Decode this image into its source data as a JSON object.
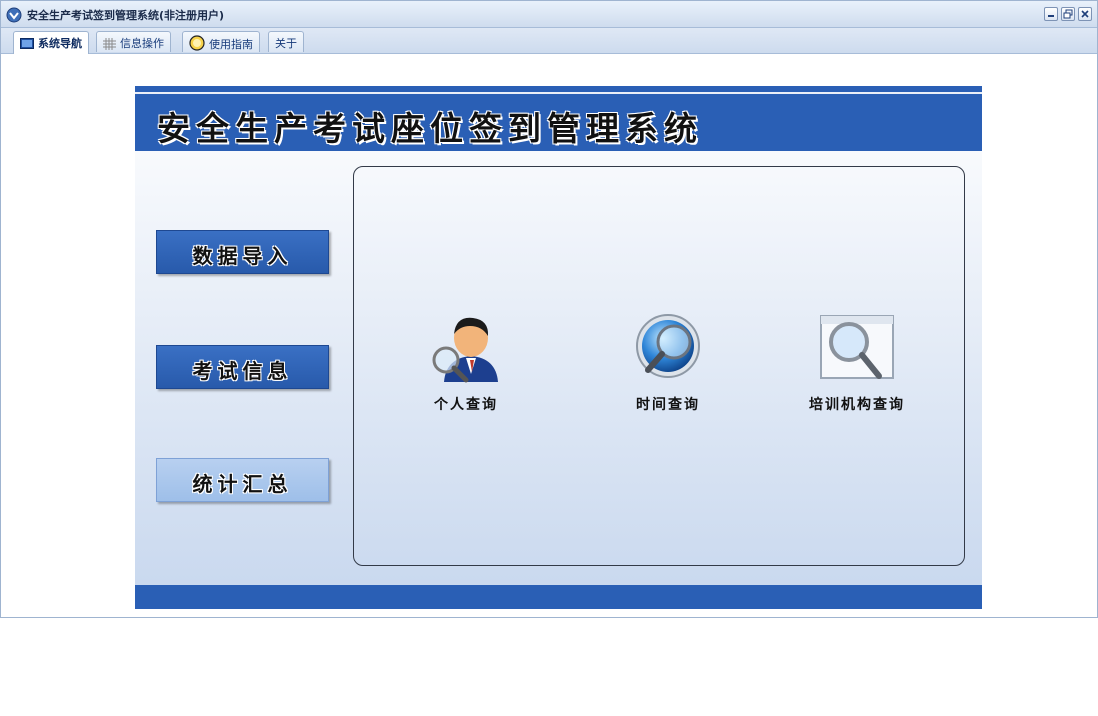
{
  "window": {
    "title": "安全生产考试签到管理系统(非注册用户)",
    "icon": "app-logo-icon",
    "controls": [
      "minimize-icon",
      "restore-icon",
      "close-icon"
    ]
  },
  "tabs": [
    {
      "label": "系统导航",
      "icon": "monitor-icon",
      "active": true
    },
    {
      "label": "信息操作",
      "icon": "grid-icon",
      "active": false
    },
    {
      "label": "使用指南",
      "icon": "help-icon",
      "active": false
    },
    {
      "label": "关于",
      "icon": "",
      "active": false
    }
  ],
  "banner": {
    "title": "安全生产考试座位签到管理系统"
  },
  "nav": [
    {
      "label": "数据导入",
      "style": "dark"
    },
    {
      "label": "考试信息",
      "style": "dark"
    },
    {
      "label": "统计汇总",
      "style": "light"
    }
  ],
  "functions": [
    {
      "label": "个人查询",
      "icon": "person-search-icon"
    },
    {
      "label": "时间查询",
      "icon": "globe-search-icon"
    },
    {
      "label": "培训机构查询",
      "icon": "window-search-icon"
    }
  ],
  "colors": {
    "banner": "#2a5fb5",
    "nav_dark": "#2a5fb5",
    "nav_light": "#a9c6ec"
  }
}
